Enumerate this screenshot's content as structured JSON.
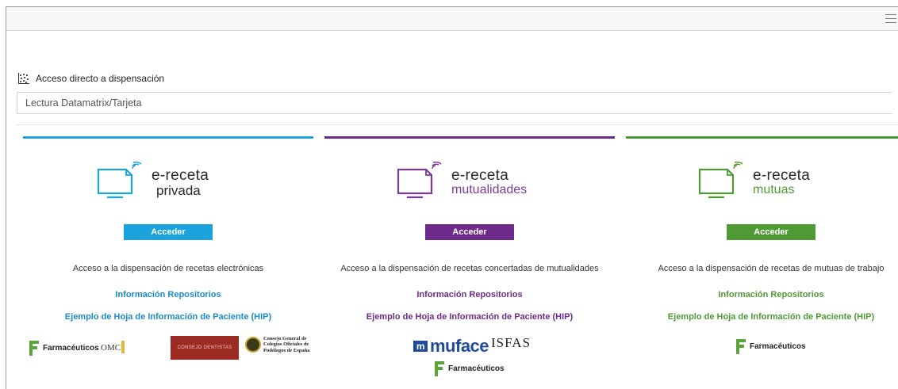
{
  "access": {
    "title": "Acceso directo a dispensación",
    "placeholder": "Lectura Datamatrix/Tarjeta"
  },
  "cards": [
    {
      "color": "#1aa3dc",
      "brand_line1": "e-receta",
      "brand_line2": "privada",
      "button": "Acceder",
      "description": "Acceso a la dispensación de recetas electrónicas",
      "link1": "Información Repositorios",
      "link2": "Ejemplo de Hoja de Información de Paciente (HIP)",
      "sponsors": [
        "Farmacéuticos",
        "OMC",
        "CONSEJO DENTISTAS",
        "Consejo General de Colegios Oficiales de Podólogos de España"
      ]
    },
    {
      "color": "#6e2b8b",
      "brand_line1": "e-receta",
      "brand_line2": "mutualidades",
      "button": "Acceder",
      "description": "Acceso a la dispensación de recetas concertadas de mutualidades",
      "link1": "Información Repositorios",
      "link2": "Ejemplo de Hoja de Información de Paciente (HIP)",
      "sponsors": [
        "muface",
        "ISFAS",
        "Farmacéuticos"
      ]
    },
    {
      "color": "#4f9a35",
      "brand_line1": "e-receta",
      "brand_line2": "mutuas",
      "button": "Acceder",
      "description": "Acceso a la dispensación de recetas de mutuas de trabajo",
      "link1": "Información Repositorios",
      "link2": "Ejemplo de Hoja de Información de Paciente (HIP)",
      "sponsors": [
        "Farmacéuticos"
      ]
    }
  ]
}
